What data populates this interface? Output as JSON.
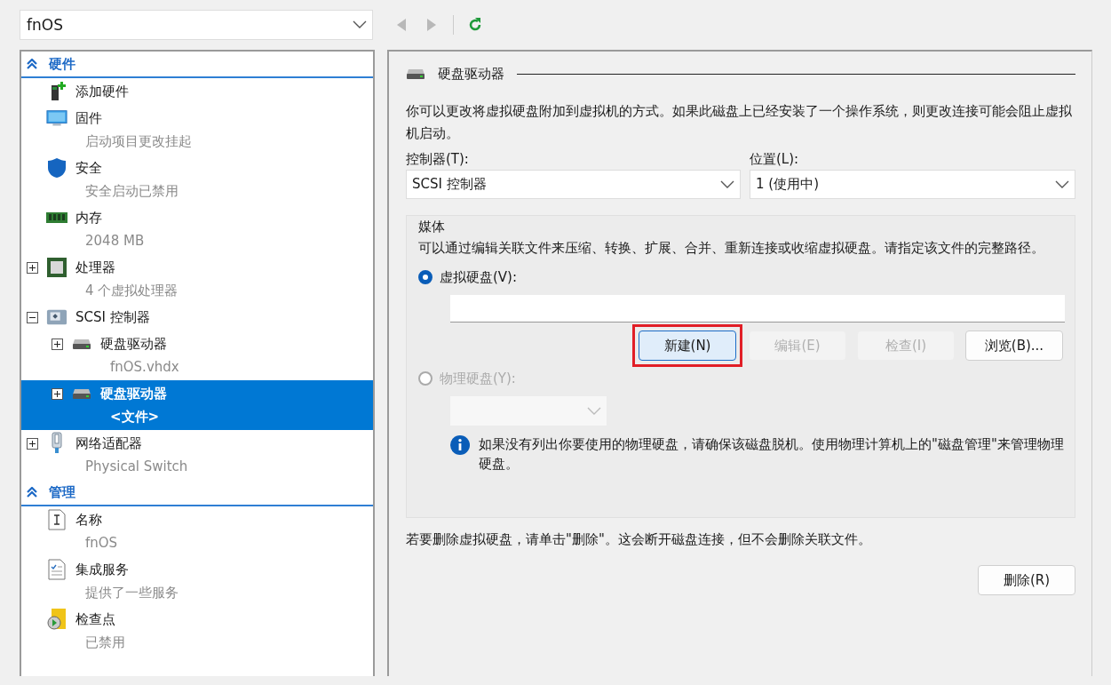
{
  "vm_selector": {
    "value": "fnOS"
  },
  "nav": {
    "back": {
      "disabled": true
    },
    "forward": {
      "disabled": true
    }
  },
  "sidebar": {
    "sections": [
      {
        "title": "硬件",
        "expanded": true,
        "items": [
          {
            "kind": "add",
            "label": "添加硬件",
            "selected": false
          },
          {
            "kind": "firmware",
            "label": "固件",
            "sublabel": "启动项目更改挂起",
            "selected": false
          },
          {
            "kind": "security",
            "label": "安全",
            "sublabel": "安全启动已禁用",
            "selected": false
          },
          {
            "kind": "memory",
            "label": "内存",
            "sublabel": "2048 MB",
            "selected": false
          },
          {
            "kind": "processor",
            "label": "处理器",
            "sublabel": "4 个虚拟处理器",
            "expanded": false,
            "selected": false
          },
          {
            "kind": "controller",
            "label": "SCSI 控制器",
            "expanded": true,
            "selected": false,
            "children": [
              {
                "kind": "disk",
                "label": "硬盘驱动器",
                "sublabel": "fnOS.vhdx",
                "expanded": false,
                "selected": false
              },
              {
                "kind": "disk",
                "label": "硬盘驱动器",
                "sublabel": "<文件>",
                "expanded": false,
                "selected": true
              }
            ]
          },
          {
            "kind": "network",
            "label": "网络适配器",
            "sublabel": "Physical Switch",
            "expanded": false,
            "selected": false
          }
        ]
      },
      {
        "title": "管理",
        "expanded": true,
        "items": [
          {
            "kind": "name",
            "label": "名称",
            "sublabel": "fnOS",
            "selected": false
          },
          {
            "kind": "integration",
            "label": "集成服务",
            "sublabel": "提供了一些服务",
            "selected": false
          },
          {
            "kind": "checkpoint",
            "label": "检查点",
            "sublabel": "已禁用",
            "selected": false
          }
        ]
      }
    ]
  },
  "details": {
    "title": "硬盘驱动器",
    "description": "你可以更改将虚拟硬盘附加到虚拟机的方式。如果此磁盘上已经安装了一个操作系统，则更改连接可能会阻止虚拟机启动。",
    "controller": {
      "label": "控制器(T):",
      "value": "SCSI 控制器"
    },
    "location": {
      "label": "位置(L):",
      "value": "1 (使用中)"
    },
    "media": {
      "title": "媒体",
      "description": "可以通过编辑关联文件来压缩、转换、扩展、合并、重新连接或收缩虚拟硬盘。请指定该文件的完整路径。",
      "virtual_disk": {
        "label": "虚拟硬盘(V):",
        "selected": true,
        "disabled": false
      },
      "buttons": [
        {
          "label": "新建(N)",
          "disabled": false,
          "focused": true,
          "highlighted": true
        },
        {
          "label": "编辑(E)",
          "disabled": true,
          "focused": false,
          "highlighted": false
        },
        {
          "label": "检查(I)",
          "disabled": true,
          "focused": false,
          "highlighted": false
        },
        {
          "label": "浏览(B)...",
          "disabled": false,
          "focused": false,
          "highlighted": false
        }
      ],
      "physical_disk": {
        "label": "物理硬盘(Y):",
        "selected": false,
        "disabled": true
      },
      "info": "如果没有列出你要使用的物理硬盘，请确保该磁盘脱机。使用物理计算机上的\"磁盘管理\"来管理物理硬盘。"
    },
    "remove_note": "若要删除虚拟硬盘，请单击\"删除\"。这会断开磁盘连接，但不会删除关联文件。",
    "remove_button": {
      "label": "删除(R)"
    }
  }
}
